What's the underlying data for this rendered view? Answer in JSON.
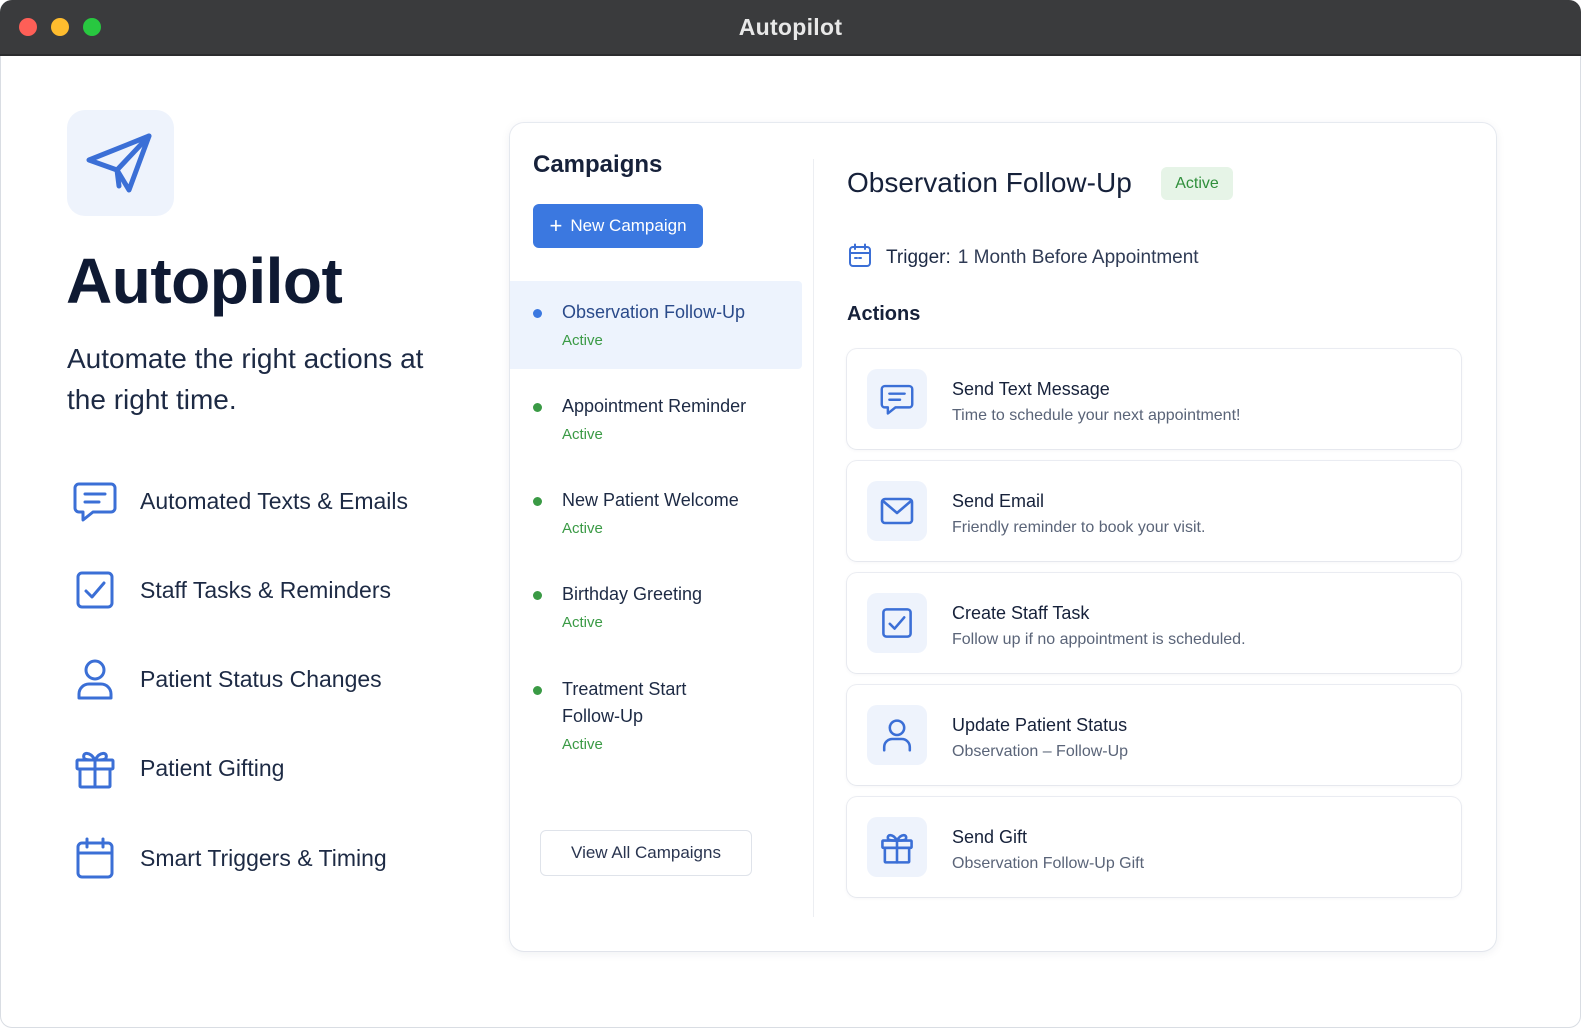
{
  "window": {
    "title": "Autopilot"
  },
  "hero": {
    "title": "Autopilot",
    "subtitle": "Automate the right actions at the right time.",
    "logo_icon": "paper-plane-icon",
    "features": [
      {
        "icon": "chat-icon",
        "label": "Automated Texts & Emails"
      },
      {
        "icon": "checkbox-icon",
        "label": "Staff Tasks & Reminders"
      },
      {
        "icon": "user-icon",
        "label": "Patient Status Changes"
      },
      {
        "icon": "gift-icon",
        "label": "Patient Gifting"
      },
      {
        "icon": "calendar-icon",
        "label": "Smart Triggers & Timing"
      }
    ]
  },
  "campaigns": {
    "heading": "Campaigns",
    "new_button": "New Campaign",
    "items": [
      {
        "name": "Observation Follow-Up",
        "status": "Active",
        "selected": true
      },
      {
        "name": "Appointment Reminder",
        "status": "Active"
      },
      {
        "name": "New Patient Welcome",
        "status": "Active"
      },
      {
        "name": "Birthday Greeting",
        "status": "Active"
      },
      {
        "name": "Treatment Start Follow-Up",
        "status": "Active"
      }
    ],
    "view_all": "View All Campaigns"
  },
  "detail": {
    "title": "Observation Follow-Up",
    "status": "Active",
    "trigger_label": "Trigger:",
    "trigger_value": "1 Month Before Appointment",
    "actions_heading": "Actions",
    "actions": [
      {
        "icon": "chat-icon",
        "title": "Send Text Message",
        "desc": "Time to schedule your next appointment!"
      },
      {
        "icon": "mail-icon",
        "title": "Send Email",
        "desc": "Friendly reminder to book your visit."
      },
      {
        "icon": "checkbox-icon",
        "title": "Create Staff Task",
        "desc": "Follow up if no appointment is scheduled."
      },
      {
        "icon": "user-icon",
        "title": "Update Patient Status",
        "desc": "Observation – Follow-Up"
      },
      {
        "icon": "gift-icon",
        "title": "Send Gift",
        "desc": "Observation Follow-Up Gift"
      }
    ]
  },
  "colors": {
    "accent": "#3b78e0",
    "selected_dot": "#3b78e0",
    "active_green": "#3a9a45",
    "icon_blue": "#3b6fd6"
  }
}
